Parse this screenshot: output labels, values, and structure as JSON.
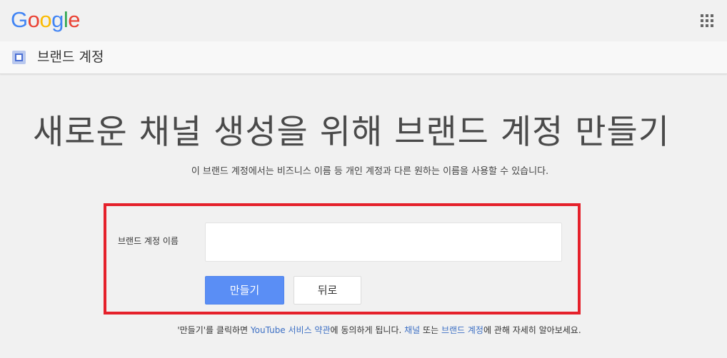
{
  "header": {
    "logo_letters": [
      "G",
      "o",
      "o",
      "g",
      "l",
      "e"
    ],
    "logo_colors": [
      "#4285f4",
      "#ea4335",
      "#fbbc05",
      "#4285f4",
      "#34a853",
      "#ea4335"
    ],
    "apps_icon": "apps-grid-icon"
  },
  "subbar": {
    "icon": "brand-account-icon",
    "title": "브랜드 계정"
  },
  "main": {
    "headline": "새로운 채널 생성을 위해 브랜드 계정 만들기",
    "subtitle": "이 브랜드 계정에서는 비즈니스 이름 등 개인 계정과 다른 원하는 이름을 사용할 수 있습니다."
  },
  "form": {
    "name_label": "브랜드 계정 이름",
    "name_value": "",
    "create_label": "만들기",
    "back_label": "뒤로",
    "highlight_color": "#e5212b",
    "primary_color": "#5a8ef5"
  },
  "footer": {
    "part1": "'만들기'를 클릭하면 ",
    "terms_link": "YouTube 서비스 약관",
    "part2": "에 동의하게 됩니다. ",
    "channel_link": "채널",
    "part3": " 또는 ",
    "brand_link": "브랜드 계정",
    "part4": "에 관해 자세히 알아보세요."
  }
}
